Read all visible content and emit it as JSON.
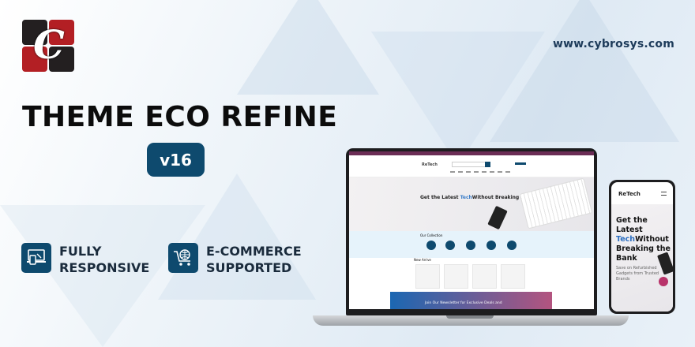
{
  "brand": {
    "site": "www.cybrosys.com",
    "colors": {
      "accent": "#0e4a6e",
      "logo_red": "#b31f24",
      "logo_dark": "#231f20"
    }
  },
  "hero": {
    "title": "THEME ECO REFINE",
    "version": "v16"
  },
  "features": [
    {
      "icon": "responsive-devices-icon",
      "line1": "FULLY",
      "line2": "RESPONSIVE"
    },
    {
      "icon": "shopping-cart-globe-icon",
      "line1": "E-COMMERCE",
      "line2": "SUPPORTED"
    }
  ],
  "laptop_screen": {
    "brand": "ReTech",
    "headline_pre": "Get the Latest ",
    "headline_accent": "Tech",
    "headline_post": "Without Breaking the Bank",
    "collection_title": "Our Collection",
    "products_title": "New Arrive",
    "newsletter": "Join Our Newsletter for Exclusive Deals and"
  },
  "phone_screen": {
    "brand": "ReTech",
    "headline_pre": "Get the Latest ",
    "headline_accent": "Tech",
    "headline_post": "Without Breaking the Bank",
    "sub": "Save on Refurbished Gadgets from Trusted Brands"
  }
}
